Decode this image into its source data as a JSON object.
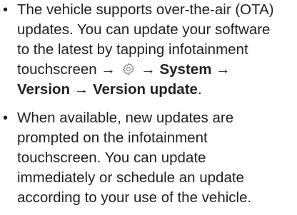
{
  "bullets": [
    {
      "marker": "•",
      "line1": "The vehicle supports over-the-air (OTA)",
      "line2": "updates. You can update your software",
      "line3": "to the latest by tapping infotainment",
      "line4_pre": "touchscreen →",
      "gear_icon": "settings-gear-icon",
      "line4_arrow": "→",
      "line4_bold": "System",
      "line4_post": "→",
      "line5_bold1": "Version",
      "line5_arrow": "→",
      "line5_bold2": "Version update",
      "line5_end": "."
    },
    {
      "marker": "•",
      "line1": "When available, new updates are",
      "line2": "prompted on the infotainment",
      "line3": "touchscreen. You can update",
      "line4": "immediately or schedule an update",
      "line5": "according to your use of the vehicle."
    }
  ]
}
